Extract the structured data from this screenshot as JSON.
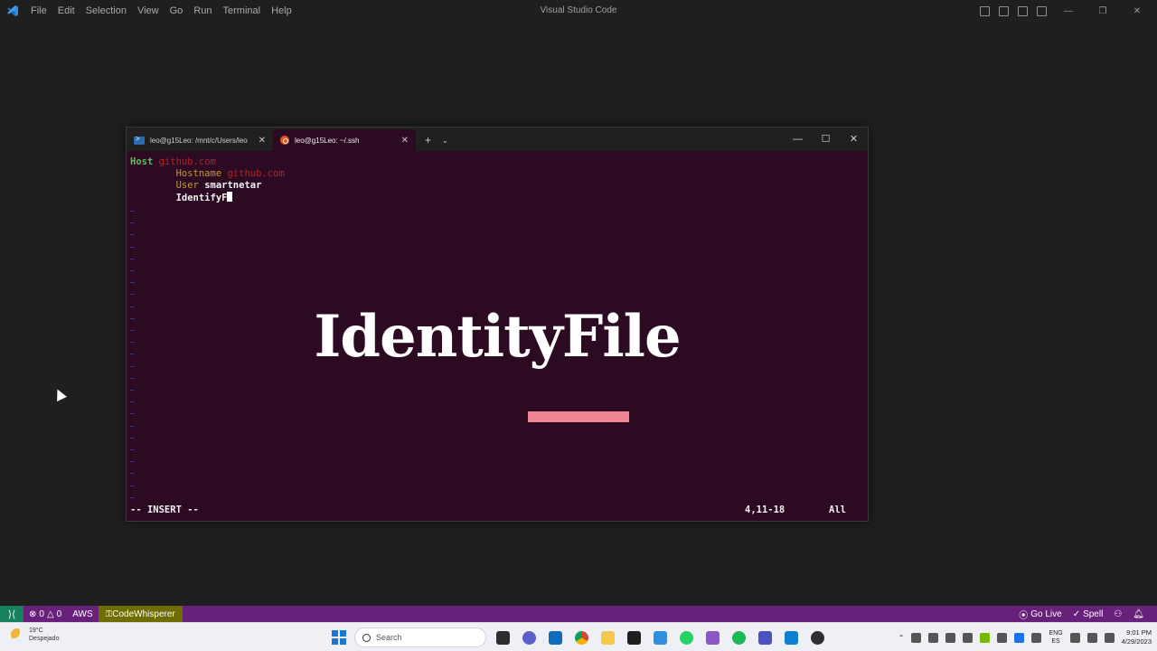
{
  "vscode": {
    "window_title": "Visual Studio Code",
    "menu": [
      "File",
      "Edit",
      "Selection",
      "View",
      "Go",
      "Run",
      "Terminal",
      "Help"
    ],
    "status_bar": {
      "remote_icon": "remote-icon",
      "errors": "0",
      "warnings": "0",
      "aws": "AWS",
      "codewhisperer": "CodeWhisperer",
      "go_live": "Go Live",
      "spell": "Spell"
    }
  },
  "terminal": {
    "tabs": [
      {
        "label": "leo@g15Leo: /mnt/c/Users/leo",
        "icon": "powershell-icon"
      },
      {
        "label": "leo@g15Leo: ~/.ssh",
        "icon": "ubuntu-icon"
      }
    ],
    "lines": {
      "l1_key": "Host",
      "l1_val": "github.com",
      "l2_key": "Hostname",
      "l2_val": "github.com",
      "l3_key": "User",
      "l3_val": "smartnetar",
      "l4_text": "IdentifyF"
    },
    "status": {
      "mode": "-- INSERT --",
      "position": "4,11-18",
      "scroll": "All"
    },
    "overlay_word": "IdentityFile",
    "overlay_bar_color": "#ef8693"
  },
  "taskbar": {
    "weather_temp": "19°C",
    "weather_desc": "Despejado",
    "search_placeholder": "Search",
    "lang_top": "ENG",
    "lang_bottom": "ES",
    "time": "9:01 PM",
    "date": "4/29/2023"
  },
  "colors": {
    "terminal_bg": "#2c0a22",
    "status_bar": "#68217a",
    "accent_green": "#16825d"
  }
}
